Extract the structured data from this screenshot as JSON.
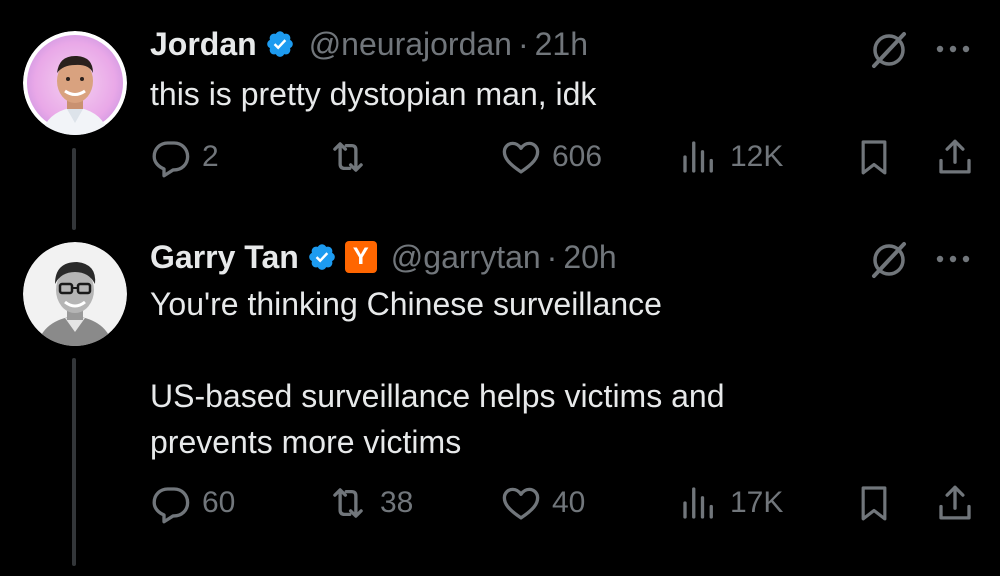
{
  "tweets": [
    {
      "author": "Jordan",
      "handle": "@neurajordan",
      "separator": "·",
      "time": "21h",
      "verified": true,
      "text_lines": [
        "this is pretty dystopian man, idk"
      ],
      "replies": "2",
      "reposts": "",
      "likes": "606",
      "views": "12K"
    },
    {
      "author": "Garry Tan",
      "handle": "@garrytan",
      "separator": "·",
      "time": "20h",
      "verified": true,
      "affiliate_badge": "Y",
      "text_lines": [
        "You're thinking Chinese surveillance",
        "",
        "US-based surveillance helps victims and",
        "prevents more victims"
      ],
      "replies": "60",
      "reposts": "38",
      "likes": "40",
      "views": "17K"
    }
  ],
  "colors": {
    "background": "#000000",
    "text_primary": "#e7e9ea",
    "text_secondary": "#71767b",
    "verified_blue": "#1d9bf0",
    "yc_orange": "#ff6600",
    "thread_line": "#333639"
  }
}
